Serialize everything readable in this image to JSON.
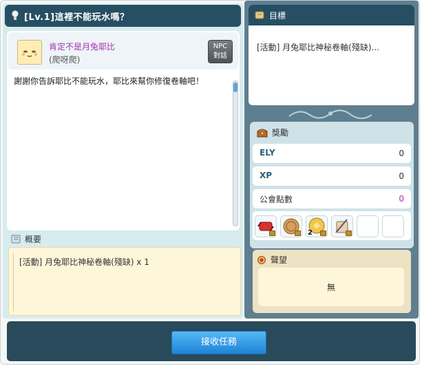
{
  "quest": {
    "title": "[Lv.1]這裡不能玩水嗎？"
  },
  "npc": {
    "name": "肯定不是月兔耶比",
    "subtitle": "(爬呀爬)",
    "talk_button": [
      "NPC",
      "對話"
    ],
    "dialogue": "謝謝你告訴耶比不能玩水，耶比來幫你修復卷軸吧！"
  },
  "summary": {
    "label": "概要",
    "text": "[活動] 月兔耶比神秘卷軸(殘缺) x 1"
  },
  "goal": {
    "label": "目標",
    "item": "[活動] 月兔耶比神秘卷軸(殘缺)..."
  },
  "rewards": {
    "label": "獎勵",
    "rows": [
      {
        "label": "ELY",
        "value": "0"
      },
      {
        "label": "XP",
        "value": "0"
      },
      {
        "label": "公會點數",
        "value": "0"
      }
    ],
    "items": [
      {
        "icon": "red-scroll-icon",
        "count": "",
        "locked": true
      },
      {
        "icon": "bronze-coin-icon",
        "count": "",
        "locked": true
      },
      {
        "icon": "gold-medal-icon",
        "count": "2",
        "locked": true
      },
      {
        "icon": "quill-scroll-icon",
        "count": "",
        "locked": true
      },
      {
        "icon": "empty-slot",
        "count": "",
        "locked": false
      },
      {
        "icon": "empty-slot",
        "count": "",
        "locked": false
      }
    ]
  },
  "fame": {
    "label": "聲望",
    "value": "無"
  },
  "footer": {
    "accept_label": "接收任務"
  },
  "colors": {
    "dark_header": "#264f63",
    "accent_blue": "#1e83d6",
    "npc_name": "#a52fb0"
  }
}
